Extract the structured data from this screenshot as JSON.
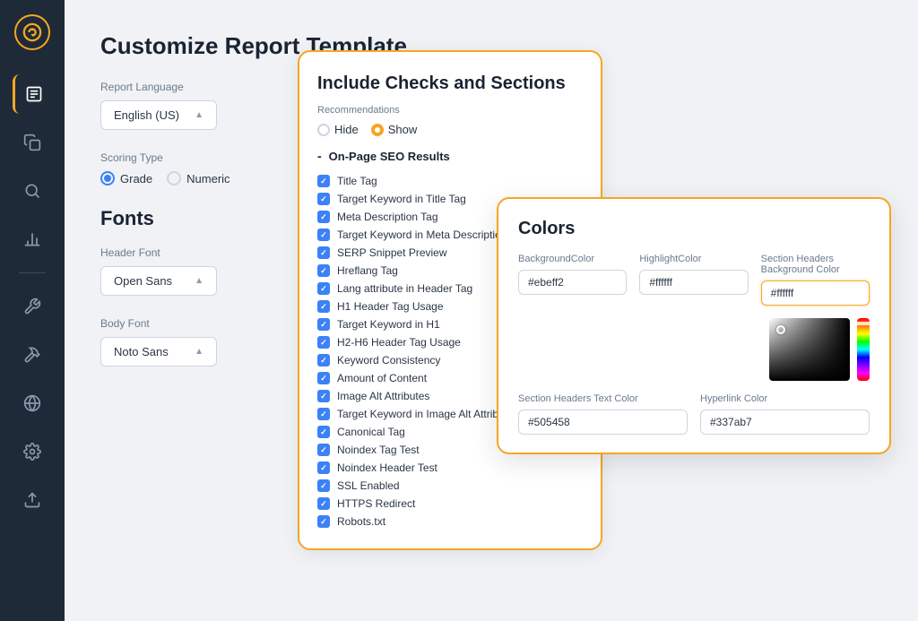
{
  "sidebar": {
    "logo_icon": "sync-icon",
    "items": [
      {
        "name": "sidebar-item-edit",
        "icon": "edit-icon",
        "active": true
      },
      {
        "name": "sidebar-item-copy",
        "icon": "copy-icon",
        "active": false
      },
      {
        "name": "sidebar-item-search",
        "icon": "search-icon",
        "active": false
      },
      {
        "name": "sidebar-item-chart",
        "icon": "chart-icon",
        "active": false
      },
      {
        "name": "sidebar-item-tool",
        "icon": "tool-icon",
        "active": false
      },
      {
        "name": "sidebar-item-hammer",
        "icon": "hammer-icon",
        "active": false
      },
      {
        "name": "sidebar-item-globe",
        "icon": "globe-icon",
        "active": false
      },
      {
        "name": "sidebar-item-settings",
        "icon": "settings-icon",
        "active": false
      },
      {
        "name": "sidebar-item-upload",
        "icon": "upload-icon",
        "active": false
      }
    ]
  },
  "page": {
    "title": "Customize Report Template"
  },
  "report_language": {
    "label": "Report Language",
    "value": "English (US)"
  },
  "scoring_type": {
    "label": "Scoring Type",
    "options": [
      {
        "label": "Grade",
        "checked": true
      },
      {
        "label": "Numeric",
        "checked": false
      }
    ]
  },
  "fonts": {
    "title": "Fonts",
    "header_font": {
      "label": "Header Font",
      "value": "Open Sans"
    },
    "body_font": {
      "label": "Body Font",
      "value": "Noto Sans"
    }
  },
  "checks": {
    "title": "Include Checks and Sections",
    "recommendations_label": "Recommendations",
    "hide_label": "Hide",
    "show_label": "Show",
    "section_title": "On-Page SEO Results",
    "items": [
      "Title Tag",
      "Target Keyword in Title Tag",
      "Meta Description Tag",
      "Target Keyword in Meta Description",
      "SERP Snippet Preview",
      "Hreflang Tag",
      "Lang attribute in Header Tag",
      "H1 Header Tag Usage",
      "Target Keyword in H1",
      "H2-H6 Header Tag Usage",
      "Keyword Consistency",
      "Amount of Content",
      "Image Alt Attributes",
      "Target Keyword in Image Alt Attributes",
      "Canonical Tag",
      "Noindex Tag Test",
      "Noindex Header Test",
      "SSL Enabled",
      "HTTPS Redirect",
      "Robots.txt"
    ]
  },
  "colors": {
    "title": "Colors",
    "fields": {
      "background_color": {
        "label": "BackgroundColor",
        "value": "#ebeff2"
      },
      "highlight_color": {
        "label": "HighlightColor",
        "value": "#ffffff"
      },
      "section_headers_bg": {
        "label": "Section Headers Background Color",
        "value": "#ffffff"
      },
      "section_headers_text": {
        "label": "Section Headers Text Color",
        "value": "#505458"
      },
      "hyperlink_color": {
        "label": "Hyperlink Color",
        "value": "#337ab7"
      }
    }
  }
}
